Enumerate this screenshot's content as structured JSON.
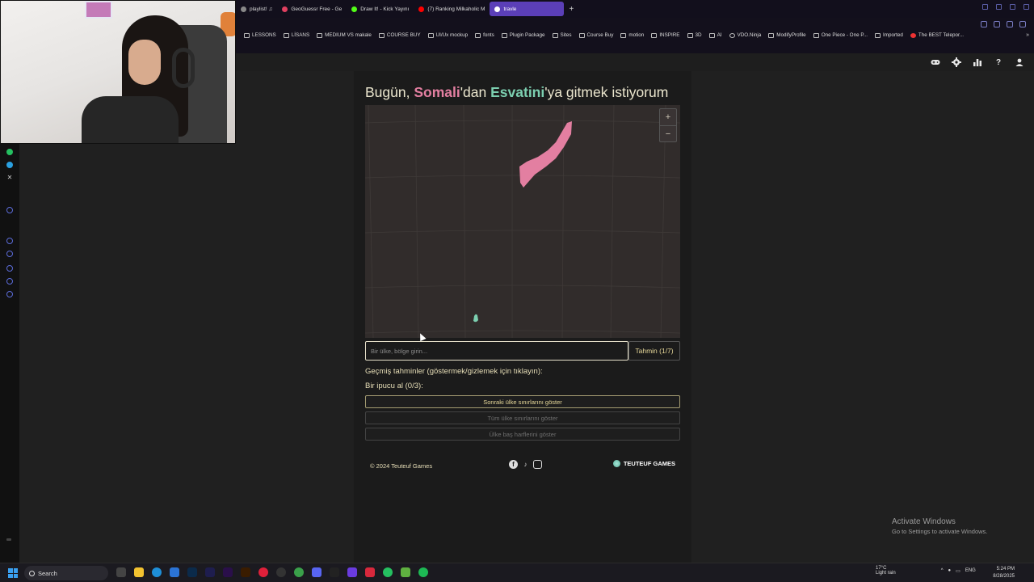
{
  "browser": {
    "tabs": [
      {
        "label": "playlist! ♫",
        "icon": "music-icon",
        "color": "#888888",
        "active": false
      },
      {
        "label": "GeoGuessr Free - Ge",
        "icon": "map-pin-icon",
        "color": "#e04060",
        "active": false
      },
      {
        "label": "Draw It! - Kick Yayını",
        "icon": "kick-icon",
        "color": "#53fc18",
        "active": false
      },
      {
        "label": "(7) Ranking Milkaholic M",
        "icon": "youtube-icon",
        "color": "#ff0000",
        "active": false
      },
      {
        "label": "travle",
        "icon": "globe-icon",
        "color": "#ffffff",
        "active": true
      }
    ],
    "new_tab": "+",
    "bookmarks": [
      {
        "label": "LESSONS",
        "icon": "folder-icon"
      },
      {
        "label": "LİSANS",
        "icon": "folder-icon"
      },
      {
        "label": "MEDIUM VS makale",
        "icon": "folder-icon"
      },
      {
        "label": "COURSE BUY",
        "icon": "folder-icon"
      },
      {
        "label": "UI/Ux mockup",
        "icon": "folder-icon"
      },
      {
        "label": "fonts",
        "icon": "folder-icon"
      },
      {
        "label": "Plugin Package",
        "icon": "folder-icon"
      },
      {
        "label": "Sites",
        "icon": "folder-icon"
      },
      {
        "label": "Course Buy",
        "icon": "folder-icon"
      },
      {
        "label": "motion",
        "icon": "folder-icon"
      },
      {
        "label": "INSPIRE",
        "icon": "folder-icon"
      },
      {
        "label": "3D",
        "icon": "folder-icon"
      },
      {
        "label": "AI",
        "icon": "folder-icon"
      },
      {
        "label": "VDO.Ninja",
        "icon": "ninja-icon"
      },
      {
        "label": "ModifyProfile",
        "icon": "profile-icon"
      },
      {
        "label": "One Piece - One P...",
        "icon": "page-icon"
      },
      {
        "label": "Imported",
        "icon": "folder-icon"
      },
      {
        "label": "The BEST Telepor...",
        "icon": "youtube-icon"
      }
    ],
    "bookmarks_more": "»"
  },
  "site_header": {
    "icons": [
      "gamepad-icon",
      "gear-icon",
      "bar-chart-icon",
      "help-icon",
      "user-icon"
    ],
    "help_glyph": "?"
  },
  "game": {
    "headline_prefix": "Bugün, ",
    "from_country": "Somali",
    "headline_mid": "'dan ",
    "to_country": "Esvatini",
    "headline_suffix": "'ya gitmek istiyorum",
    "from_color": "#e37fa1",
    "to_color": "#7ccfb0",
    "zoom_in": "+",
    "zoom_out": "−",
    "input_placeholder": "Bir ülke, bölge girin...",
    "guess_button": "Tahmin (1/7)",
    "history_label": "Geçmiş tahminler (göstermek/gizlemek için tıklayın):",
    "hint_label": "Bir ipucu al (0/3):",
    "hint_buttons": [
      "Sonraki ülke sınırlarını göster",
      "Tüm ülke sınırlarını göster",
      "Ülke baş harflerini göster"
    ]
  },
  "footer": {
    "copyright": "© 2024 Teuteuf Games",
    "socials": [
      "facebook-icon",
      "tiktok-icon",
      "instagram-icon"
    ],
    "brand": "TEUTEUF GAMES"
  },
  "watermark": {
    "title": "Activate Windows",
    "subtitle": "Go to Settings to activate Windows."
  },
  "taskbar": {
    "search_label": "Search",
    "weather_temp": "17°C",
    "weather_desc": "Light rain",
    "lang": "ENG",
    "time": "5:24 PM",
    "date": "8/28/2025"
  }
}
